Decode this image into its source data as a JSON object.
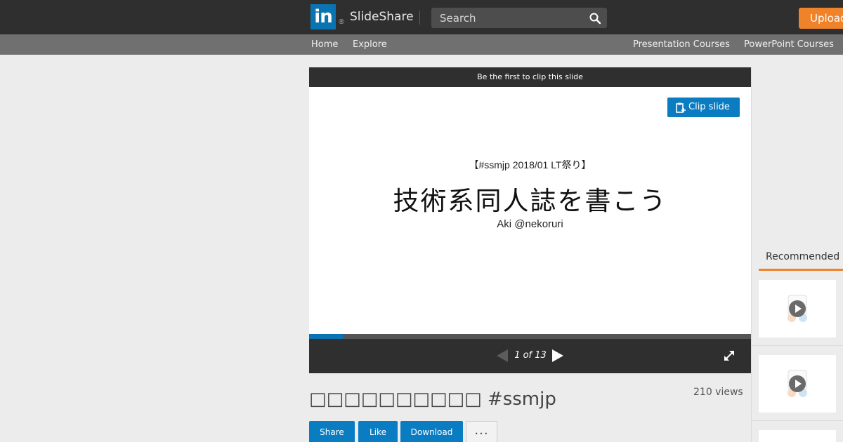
{
  "header": {
    "logo_text": "in",
    "logo_mark": "®",
    "brand": "SlideShare",
    "search_placeholder": "Search",
    "upload_label": "Upload"
  },
  "nav": {
    "left": [
      "Home",
      "Explore"
    ],
    "right": [
      "Presentation Courses",
      "PowerPoint Courses"
    ]
  },
  "player": {
    "clip_banner": "Be the first to clip this slide",
    "clip_button": "Clip slide",
    "slide": {
      "subtitle": "【#ssmjp 2018/01 LT祭り】",
      "title": "技術系同人誌を書こう",
      "author": "Aki @nekoruri"
    },
    "pager": "1 of 13",
    "progress": 0.077
  },
  "document": {
    "title": "□□□□□□□□□□ #ssmjp",
    "views": "210 views",
    "actions": [
      "Share",
      "Like",
      "Download"
    ],
    "more_label": "..."
  },
  "sidebar": {
    "recommended_label": "Recommended"
  },
  "colors": {
    "accent": "#0a7cc2",
    "upload": "#f0822a",
    "dark": "#2f2f2f"
  }
}
